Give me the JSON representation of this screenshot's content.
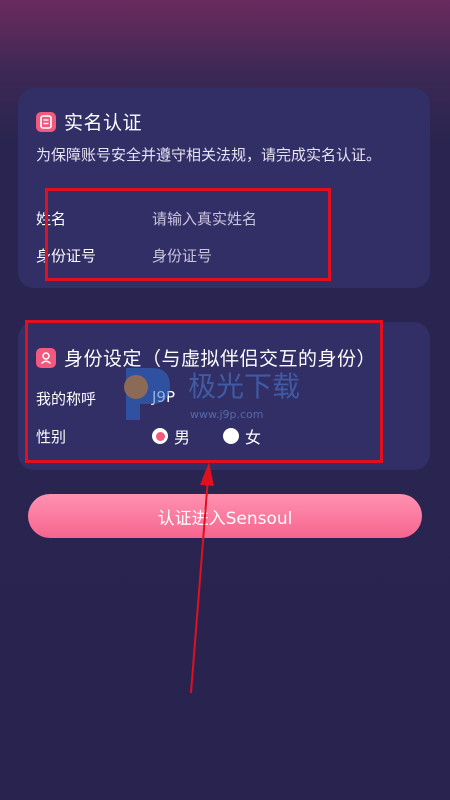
{
  "realname_card": {
    "title": "实名认证",
    "icon": "id-card-icon",
    "description": "为保障账号安全并遵守相关法规，请完成实名认证。",
    "fields": [
      {
        "label": "姓名",
        "placeholder": "请输入真实姓名"
      },
      {
        "label": "身份证号",
        "placeholder": "身份证号"
      }
    ]
  },
  "identity_card": {
    "title": "身份设定（与虚拟伴侣交互的身份）",
    "icon": "person-icon",
    "nickname_label": "我的称呼",
    "nickname_value": "J9P",
    "gender_label": "性别",
    "gender_options": [
      "男",
      "女"
    ],
    "gender_selected": "男"
  },
  "submit_button": {
    "label": "认证进入Sensoul"
  },
  "watermark": {
    "text": "极光下载",
    "url": "www.j9p.com"
  },
  "colors": {
    "accent": "#f2597f",
    "card": "#322e66",
    "annotation": "#e0101e"
  }
}
